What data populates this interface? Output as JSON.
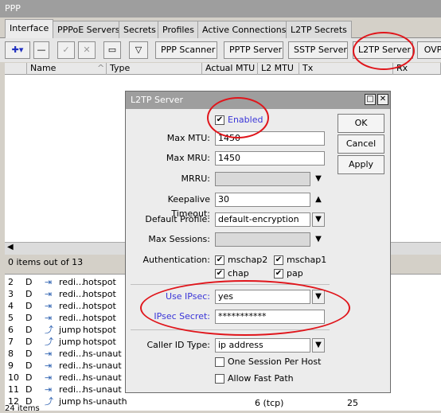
{
  "window": {
    "title": "PPP"
  },
  "tabs": [
    "Interface",
    "PPPoE Servers",
    "Secrets",
    "Profiles",
    "Active Connections",
    "L2TP Secrets"
  ],
  "toolbar": {
    "add_label": "✚▾",
    "buttons": [
      "PPP Scanner",
      "PPTP Server",
      "SSTP Server",
      "L2TP Server",
      "OVP"
    ]
  },
  "grid": {
    "columns": [
      "Name",
      "Type",
      "Actual MTU",
      "L2 MTU",
      "Tx",
      "Rx"
    ],
    "status": "0 items out of 13"
  },
  "lower_rows": [
    {
      "num": "2",
      "flag": "D",
      "name": "redi...",
      "type": "hotspot"
    },
    {
      "num": "3",
      "flag": "D",
      "name": "redi...",
      "type": "hotspot"
    },
    {
      "num": "4",
      "flag": "D",
      "name": "redi...",
      "type": "hotspot"
    },
    {
      "num": "5",
      "flag": "D",
      "name": "redi...",
      "type": "hotspot"
    },
    {
      "num": "6",
      "flag": "D",
      "name": "jump",
      "type": "hotspot"
    },
    {
      "num": "7",
      "flag": "D",
      "name": "jump",
      "type": "hotspot"
    },
    {
      "num": "8",
      "flag": "D",
      "name": "redi...",
      "type": "hs-unaut"
    },
    {
      "num": "9",
      "flag": "D",
      "name": "redi...",
      "type": "hs-unaut"
    },
    {
      "num": "10",
      "flag": "D",
      "name": "redi...",
      "type": "hs-unaut"
    },
    {
      "num": "11",
      "flag": "D",
      "name": "redi...",
      "type": "hs-unaut"
    },
    {
      "num": "12",
      "flag": "D",
      "name": "jump",
      "type": "hs-unauth"
    }
  ],
  "lower_extra": {
    "col_tcp": "6 (tcp)",
    "col_val": "25",
    "footer": "24 items"
  },
  "dialog": {
    "title": "L2TP Server",
    "enabled_label": "Enabled",
    "max_mtu_label": "Max MTU:",
    "max_mtu": "1450",
    "max_mru_label": "Max MRU:",
    "max_mru": "1450",
    "mrru_label": "MRRU:",
    "mrru": "",
    "keepalive_label": "Keepalive Timeout:",
    "keepalive": "30",
    "default_profile_label": "Default Profile:",
    "default_profile": "default-encryption",
    "max_sessions_label": "Max Sessions:",
    "max_sessions": "",
    "auth_label": "Authentication:",
    "auth_options": [
      "mschap2",
      "mschap1",
      "chap",
      "pap"
    ],
    "use_ipsec_label": "Use IPsec:",
    "use_ipsec": "yes",
    "ipsec_secret_label": "IPsec Secret:",
    "ipsec_secret": "***********",
    "caller_id_label": "Caller ID Type:",
    "caller_id": "ip address",
    "one_session_label": "One Session Per Host",
    "fast_path_label": "Allow Fast Path",
    "ok_label": "OK",
    "cancel_label": "Cancel",
    "apply_label": "Apply"
  },
  "colors": {
    "highlight": "#e0151b",
    "link_blue": "#3a35d8"
  }
}
